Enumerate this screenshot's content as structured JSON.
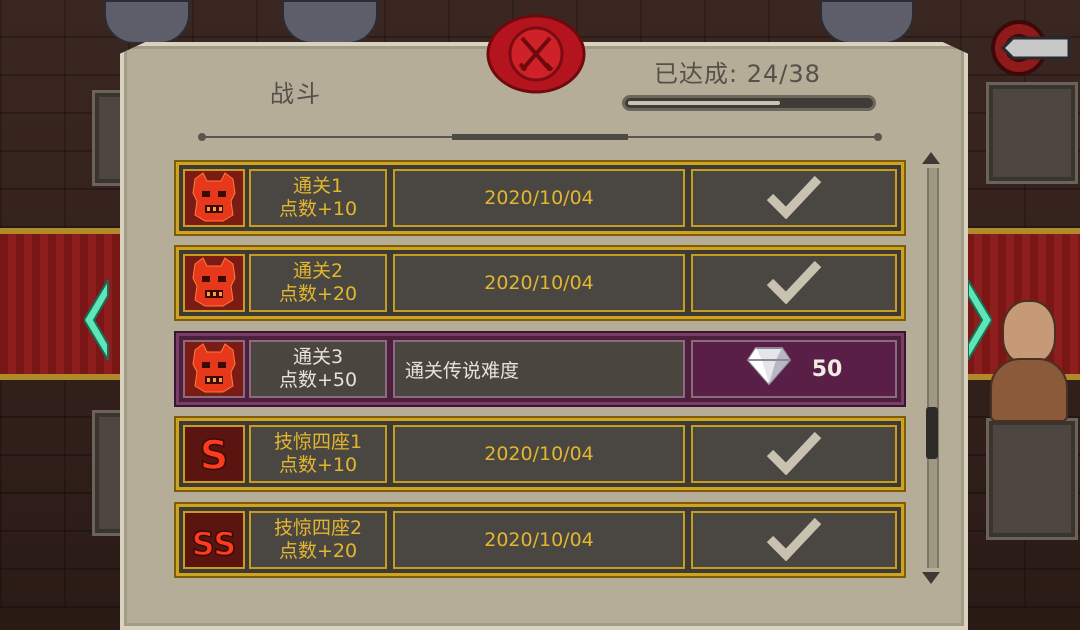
{
  "header": {
    "category": "战斗",
    "achieved": "已达成: 24/38",
    "progress_fraction": 0.63
  },
  "colors": {
    "accent_gold": "#d0a31e",
    "highlight_purple": "#5a1f46",
    "seal_red": "#b3141d"
  },
  "rows": [
    {
      "icon": "demon-face-icon",
      "name_line1": "通关1",
      "name_line2": "点数+10",
      "info": "2020/10/04",
      "status": "completed"
    },
    {
      "icon": "demon-face-icon",
      "name_line1": "通关2",
      "name_line2": "点数+20",
      "info": "2020/10/04",
      "status": "completed"
    },
    {
      "icon": "demon-face-icon",
      "name_line1": "通关3",
      "name_line2": "点数+50",
      "info": "通关传说难度",
      "status": "reward",
      "reward_amount": "50",
      "reward_icon": "diamond-icon"
    },
    {
      "icon": "s-rank-icon",
      "icon_text": "S",
      "name_line1": "技惊四座1",
      "name_line2": "点数+10",
      "info": "2020/10/04",
      "status": "completed"
    },
    {
      "icon": "ss-rank-icon",
      "icon_text": "SS",
      "name_line1": "技惊四座2",
      "name_line2": "点数+20",
      "info": "2020/10/04",
      "status": "completed"
    }
  ]
}
